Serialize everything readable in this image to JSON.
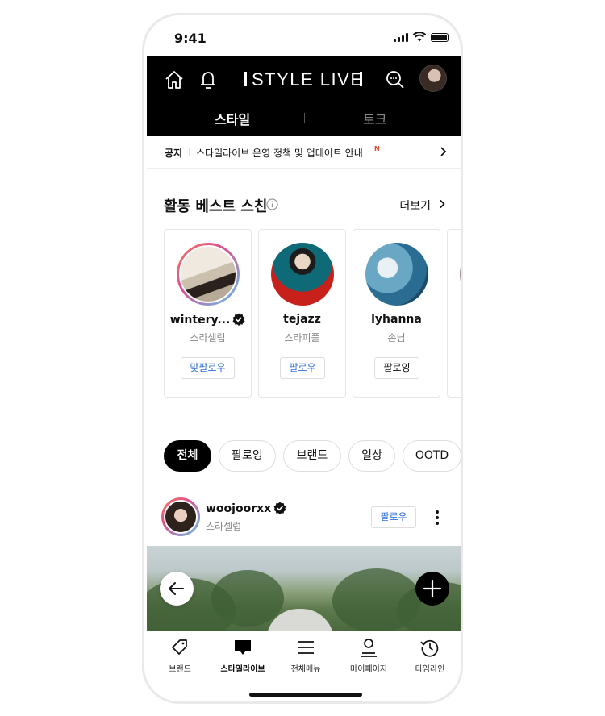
{
  "status_bar": {
    "time": "9:41"
  },
  "header": {
    "logo": "STYLE LIVE",
    "tabs": [
      {
        "label": "스타일",
        "active": true
      },
      {
        "label": "토크",
        "active": false
      }
    ]
  },
  "notice": {
    "label": "공지",
    "text": "스타일라이브 운영 정책 및 업데이트 안내",
    "badge": "N",
    "badge_color": "#e8452c"
  },
  "best_skins": {
    "title": "활동 베스트 스친",
    "more_label": "더보기",
    "users": [
      {
        "name": "wintery...",
        "verified": true,
        "role": "스라셀럽",
        "button": "맞팔로우"
      },
      {
        "name": "tejazz",
        "verified": false,
        "role": "스라피플",
        "button": "팔로우"
      },
      {
        "name": "lyhanna",
        "verified": false,
        "role": "손님",
        "button": "팔로잉"
      }
    ]
  },
  "filters": [
    {
      "label": "전체",
      "active": true
    },
    {
      "label": "팔로잉",
      "active": false
    },
    {
      "label": "브랜드",
      "active": false
    },
    {
      "label": "일상",
      "active": false
    },
    {
      "label": "OOTD",
      "active": false
    }
  ],
  "post": {
    "username": "woojoorxx",
    "verified": true,
    "role": "스라셀럽",
    "follow_label": "팔로우"
  },
  "bottom_nav": [
    {
      "label": "브랜드",
      "icon": "tag-icon",
      "active": false
    },
    {
      "label": "스타일라이브",
      "icon": "chat-bubble-icon",
      "active": true
    },
    {
      "label": "전체메뉴",
      "icon": "menu-icon",
      "active": false
    },
    {
      "label": "마이페이지",
      "icon": "person-icon",
      "active": false
    },
    {
      "label": "타임라인",
      "icon": "history-icon",
      "active": false
    }
  ],
  "colors": {
    "accent_blue": "#2f6fd8",
    "header_bg": "#000000"
  }
}
